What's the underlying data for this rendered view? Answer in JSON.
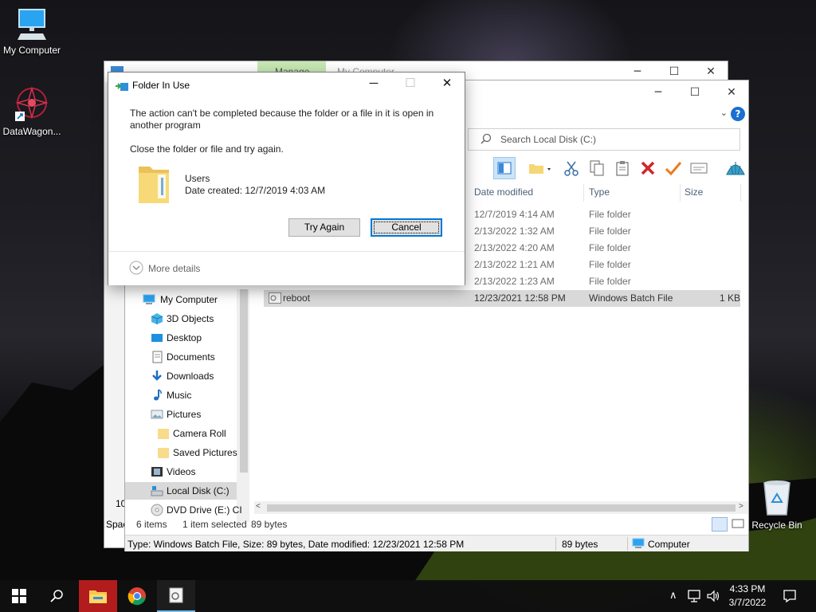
{
  "desktop": {
    "icons": [
      {
        "label": "My Computer",
        "icon": "computer-icon"
      },
      {
        "label": "DataWagon...",
        "icon": "datawagon-shortcut-icon"
      },
      {
        "label": "Recycle Bin",
        "icon": "recycle-bin-icon"
      }
    ]
  },
  "back_window": {
    "ribbon_tab": "Manage",
    "title": "My Computer",
    "item_count_fragment": "10",
    "status_fragment": "Spac"
  },
  "explorer": {
    "title_fragment": ":)",
    "search_placeholder": "Search Local Disk (C:)",
    "columns": [
      "Date modified",
      "Type",
      "Size"
    ],
    "rows": [
      {
        "name": "",
        "date": "12/7/2019 4:14 AM",
        "type": "File folder",
        "size": ""
      },
      {
        "name": "",
        "date": "2/13/2022 1:32 AM",
        "type": "File folder",
        "size": ""
      },
      {
        "name": "",
        "date": "2/13/2022 4:20 AM",
        "type": "File folder",
        "size": ""
      },
      {
        "name": "",
        "date": "2/13/2022 1:21 AM",
        "type": "File folder",
        "size": ""
      },
      {
        "name": "",
        "date": "2/13/2022 1:23 AM",
        "type": "File folder",
        "size": ""
      },
      {
        "name": "reboot",
        "date": "12/23/2021 12:58 PM",
        "type": "Windows Batch File",
        "size": "1 KB"
      }
    ],
    "nav": [
      {
        "label": "My Computer",
        "icon": "computer-icon",
        "level": 0
      },
      {
        "label": "3D Objects",
        "icon": "3d-objects-icon",
        "level": 1
      },
      {
        "label": "Desktop",
        "icon": "desktop-icon",
        "level": 1
      },
      {
        "label": "Documents",
        "icon": "documents-icon",
        "level": 1
      },
      {
        "label": "Downloads",
        "icon": "downloads-icon",
        "level": 1
      },
      {
        "label": "Music",
        "icon": "music-icon",
        "level": 1
      },
      {
        "label": "Pictures",
        "icon": "pictures-icon",
        "level": 1
      },
      {
        "label": "Camera Roll",
        "icon": "folder-icon",
        "level": 2
      },
      {
        "label": "Saved Pictures",
        "icon": "folder-icon",
        "level": 2
      },
      {
        "label": "Videos",
        "icon": "videos-icon",
        "level": 1
      },
      {
        "label": "Local Disk (C:)",
        "icon": "local-disk-icon",
        "level": 1
      },
      {
        "label": "DVD Drive (E:) CI",
        "icon": "dvd-drive-icon",
        "level": 1
      }
    ],
    "status": {
      "items": "6 items",
      "selected": "1 item selected",
      "size": "89 bytes"
    },
    "details_bar": {
      "info": "Type: Windows Batch File, Size: 89 bytes, Date modified: 12/23/2021 12:58 PM",
      "size": "89 bytes",
      "location": "Computer"
    }
  },
  "dialog": {
    "title": "Folder In Use",
    "message": "The action can't be completed because the folder or a file in it is open in another program",
    "instruction": "Close the folder or file and try again.",
    "item_name": "Users",
    "item_date": "Date created: 12/7/2019 4:03 AM",
    "try_again_label": "Try Again",
    "cancel_label": "Cancel",
    "more_details_label": "More details"
  },
  "taskbar": {
    "time": "4:33 PM",
    "date": "3/7/2022"
  },
  "colors": {
    "accent": "#0078d7",
    "taskbar_active": "#b31c1c",
    "manage_tab": "#c6e8b2",
    "selection": "#d9d9d9"
  }
}
